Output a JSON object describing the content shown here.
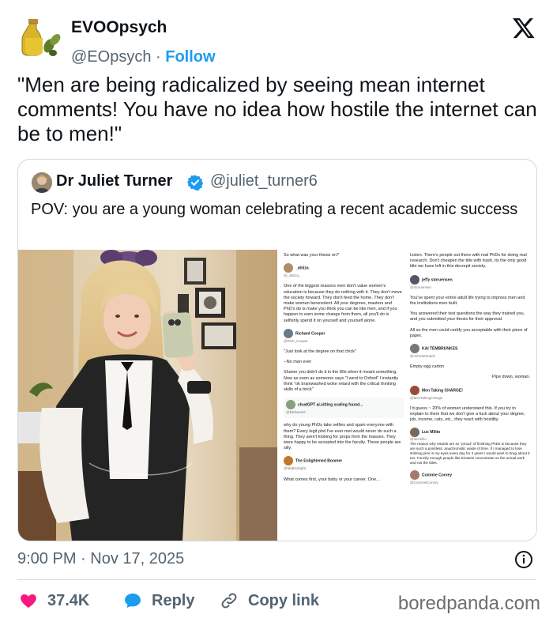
{
  "author": {
    "name": "EVOOpsych",
    "handle": "@EOpsych",
    "separator": "·",
    "follow_label": "Follow"
  },
  "tweet_text": "\"Men are being radicalized by seeing mean internet comments! You have no idea how hostile the internet can be to men!\"",
  "quoted": {
    "name": "Dr Juliet Turner",
    "handle": "@juliet_turner6",
    "text": "POV: you are a young woman celebrating a recent academic success",
    "screenshot": {
      "left_col": {
        "q1": "So what was your thesis on?",
        "u1_name": "_ahiiza",
        "u1_handle": "@_ahiiza_",
        "c1": "One of the biggest reasons men don't value women's education is because they do nothing with it. They don't move the society forward. They don't feed the home. They don't make women benevolent. All your degrees, masters and PhD's do is make you think you can be like men, and if you happen to earn some change from them, all you'll do is selfishly spend it on yourself and yourself alone.",
        "u2_name": "Richard Cooper",
        "u2_handle": "@Rich_Cooper",
        "c2": "\"Just look at the degree on that chick\"",
        "c3": "--No man ever",
        "c4": "Shame you didn't do it in the 80s when it meant something. Now as soon as someone says \"I went to Oxford\" I instantly think \"ok brainwashed woke retard with the critical thinking skills of a brick\"",
        "u3_name": "chudGPT ai.sitting scaling found...",
        "u3_handle": "@BShweetz",
        "c5": "why do young PhDs take selfies and spam everyone with them? Every legit phd I've ever met would never do such a thing. They aren't looking for props from the masses. They were happy to be accepted into the faculty. These people are silly.",
        "u4_name": "The Enlightened Boomer",
        "u4_handle": "@MyBirdsight",
        "c6": "What comes first, your baby or your career. One..."
      },
      "right_col": {
        "c1": "Listen. There's people out there with real PhDs for doing real research. Don't cheapen the title with trash, its the only good title we have left in this decrepit society.",
        "u1_name": "jeffy storuensen",
        "u1_handle": "@storuensen",
        "c2": "You've spent your entire adult life trying to impress men and the institutions men built.",
        "c3": "You answered their test questions the way they trained you, and you submitted your thesis for their approval.",
        "c4": "All so the men could certify you acceptable with their piece of paper.",
        "u2_name": "KAI TEMBRUNKES",
        "u2_handle": "@JohnWomack",
        "c5": "Empty egg carton",
        "c6": "Pipe down, woman.",
        "u3_name": "Men Taking CHARGE!",
        "u3_handle": "@MenTakingCharge",
        "c7": "I'd guess ~ 20% of women understand this. If you try to explain to them that we don't give a fuck about your degree, job, income, cats, etc., they react with hostility.",
        "u4_name": "Luc Milito",
        "u4_handle": "@lucmilito",
        "c8": "The reason why retards are so \"proud\" of finishing PhDs is because they are such a pointless, anachronistic waste of time. If I managed to lose stinking pins in my eyes every day for 4 years I would want to brag about it too. Funnily enough people like Einstein concentrate on the actual work and not the titles.",
        "u5_name": "Commie Corvey",
        "u5_handle": "@CommieCorvey"
      }
    }
  },
  "meta": {
    "time": "9:00 PM",
    "separator": "·",
    "date": "Nov 17, 2025"
  },
  "actions": {
    "likes": "37.4K",
    "reply_label": "Reply",
    "copy_label": "Copy link"
  },
  "watermark": "boredpanda.com",
  "colors": {
    "accent": "#1d9bf0",
    "like": "#f91880",
    "text": "#0f1419",
    "muted": "#536471",
    "border": "#cfd9de"
  }
}
